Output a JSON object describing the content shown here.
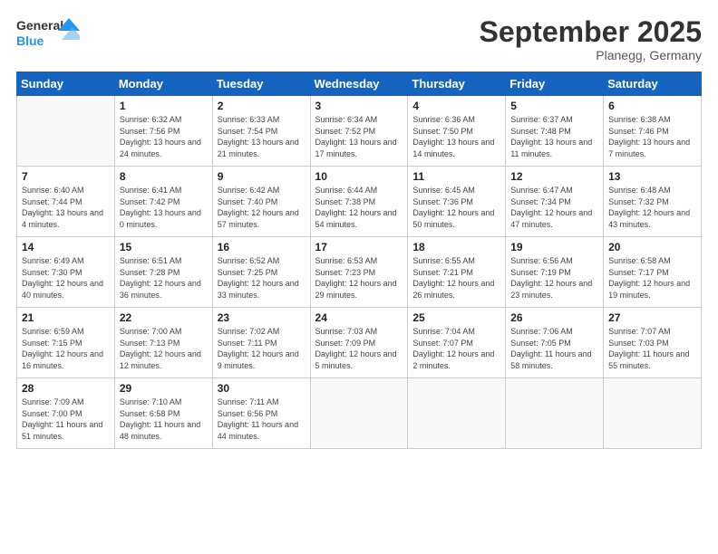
{
  "logo": {
    "line1": "General",
    "line2": "Blue"
  },
  "title": "September 2025",
  "location": "Planegg, Germany",
  "days_header": [
    "Sunday",
    "Monday",
    "Tuesday",
    "Wednesday",
    "Thursday",
    "Friday",
    "Saturday"
  ],
  "weeks": [
    [
      {
        "num": "",
        "info": ""
      },
      {
        "num": "1",
        "info": "Sunrise: 6:32 AM\nSunset: 7:56 PM\nDaylight: 13 hours and 24 minutes."
      },
      {
        "num": "2",
        "info": "Sunrise: 6:33 AM\nSunset: 7:54 PM\nDaylight: 13 hours and 21 minutes."
      },
      {
        "num": "3",
        "info": "Sunrise: 6:34 AM\nSunset: 7:52 PM\nDaylight: 13 hours and 17 minutes."
      },
      {
        "num": "4",
        "info": "Sunrise: 6:36 AM\nSunset: 7:50 PM\nDaylight: 13 hours and 14 minutes."
      },
      {
        "num": "5",
        "info": "Sunrise: 6:37 AM\nSunset: 7:48 PM\nDaylight: 13 hours and 11 minutes."
      },
      {
        "num": "6",
        "info": "Sunrise: 6:38 AM\nSunset: 7:46 PM\nDaylight: 13 hours and 7 minutes."
      }
    ],
    [
      {
        "num": "7",
        "info": "Sunrise: 6:40 AM\nSunset: 7:44 PM\nDaylight: 13 hours and 4 minutes."
      },
      {
        "num": "8",
        "info": "Sunrise: 6:41 AM\nSunset: 7:42 PM\nDaylight: 13 hours and 0 minutes."
      },
      {
        "num": "9",
        "info": "Sunrise: 6:42 AM\nSunset: 7:40 PM\nDaylight: 12 hours and 57 minutes."
      },
      {
        "num": "10",
        "info": "Sunrise: 6:44 AM\nSunset: 7:38 PM\nDaylight: 12 hours and 54 minutes."
      },
      {
        "num": "11",
        "info": "Sunrise: 6:45 AM\nSunset: 7:36 PM\nDaylight: 12 hours and 50 minutes."
      },
      {
        "num": "12",
        "info": "Sunrise: 6:47 AM\nSunset: 7:34 PM\nDaylight: 12 hours and 47 minutes."
      },
      {
        "num": "13",
        "info": "Sunrise: 6:48 AM\nSunset: 7:32 PM\nDaylight: 12 hours and 43 minutes."
      }
    ],
    [
      {
        "num": "14",
        "info": "Sunrise: 6:49 AM\nSunset: 7:30 PM\nDaylight: 12 hours and 40 minutes."
      },
      {
        "num": "15",
        "info": "Sunrise: 6:51 AM\nSunset: 7:28 PM\nDaylight: 12 hours and 36 minutes."
      },
      {
        "num": "16",
        "info": "Sunrise: 6:52 AM\nSunset: 7:25 PM\nDaylight: 12 hours and 33 minutes."
      },
      {
        "num": "17",
        "info": "Sunrise: 6:53 AM\nSunset: 7:23 PM\nDaylight: 12 hours and 29 minutes."
      },
      {
        "num": "18",
        "info": "Sunrise: 6:55 AM\nSunset: 7:21 PM\nDaylight: 12 hours and 26 minutes."
      },
      {
        "num": "19",
        "info": "Sunrise: 6:56 AM\nSunset: 7:19 PM\nDaylight: 12 hours and 23 minutes."
      },
      {
        "num": "20",
        "info": "Sunrise: 6:58 AM\nSunset: 7:17 PM\nDaylight: 12 hours and 19 minutes."
      }
    ],
    [
      {
        "num": "21",
        "info": "Sunrise: 6:59 AM\nSunset: 7:15 PM\nDaylight: 12 hours and 16 minutes."
      },
      {
        "num": "22",
        "info": "Sunrise: 7:00 AM\nSunset: 7:13 PM\nDaylight: 12 hours and 12 minutes."
      },
      {
        "num": "23",
        "info": "Sunrise: 7:02 AM\nSunset: 7:11 PM\nDaylight: 12 hours and 9 minutes."
      },
      {
        "num": "24",
        "info": "Sunrise: 7:03 AM\nSunset: 7:09 PM\nDaylight: 12 hours and 5 minutes."
      },
      {
        "num": "25",
        "info": "Sunrise: 7:04 AM\nSunset: 7:07 PM\nDaylight: 12 hours and 2 minutes."
      },
      {
        "num": "26",
        "info": "Sunrise: 7:06 AM\nSunset: 7:05 PM\nDaylight: 11 hours and 58 minutes."
      },
      {
        "num": "27",
        "info": "Sunrise: 7:07 AM\nSunset: 7:03 PM\nDaylight: 11 hours and 55 minutes."
      }
    ],
    [
      {
        "num": "28",
        "info": "Sunrise: 7:09 AM\nSunset: 7:00 PM\nDaylight: 11 hours and 51 minutes."
      },
      {
        "num": "29",
        "info": "Sunrise: 7:10 AM\nSunset: 6:58 PM\nDaylight: 11 hours and 48 minutes."
      },
      {
        "num": "30",
        "info": "Sunrise: 7:11 AM\nSunset: 6:56 PM\nDaylight: 11 hours and 44 minutes."
      },
      {
        "num": "",
        "info": ""
      },
      {
        "num": "",
        "info": ""
      },
      {
        "num": "",
        "info": ""
      },
      {
        "num": "",
        "info": ""
      }
    ]
  ]
}
